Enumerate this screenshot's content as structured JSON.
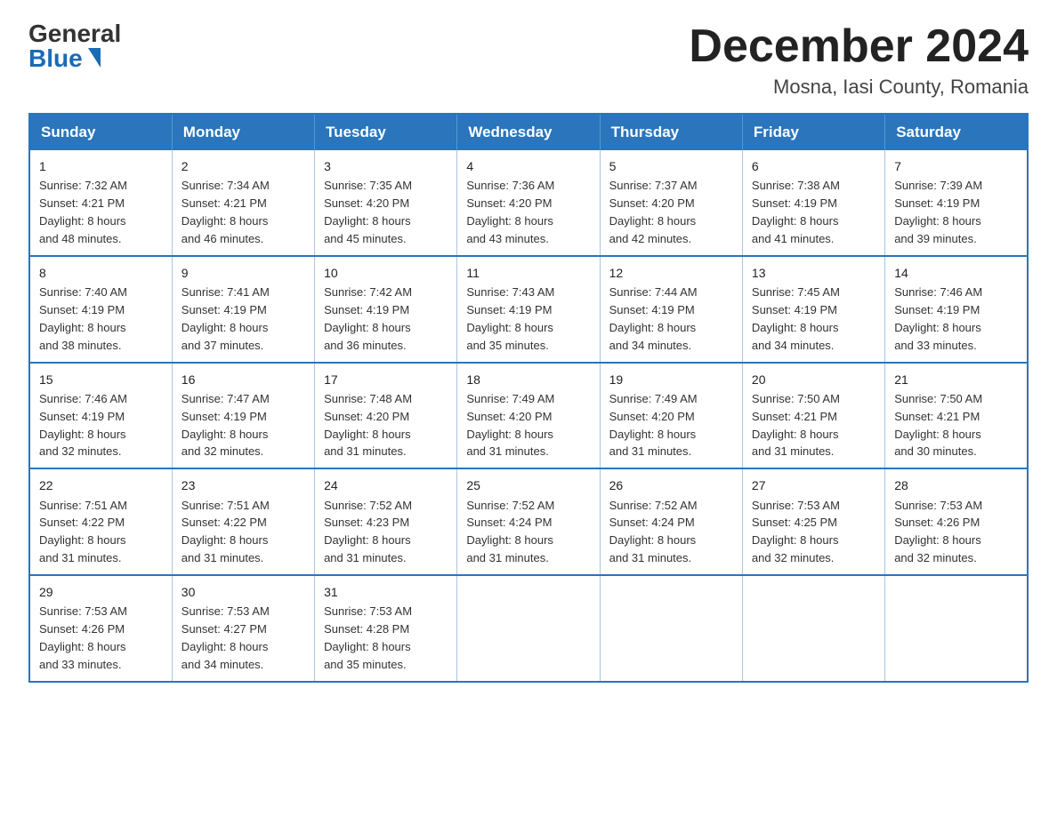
{
  "logo": {
    "general": "General",
    "blue": "Blue",
    "triangle": "▶"
  },
  "title": "December 2024",
  "location": "Mosna, Iasi County, Romania",
  "days_of_week": [
    "Sunday",
    "Monday",
    "Tuesday",
    "Wednesday",
    "Thursday",
    "Friday",
    "Saturday"
  ],
  "weeks": [
    [
      {
        "day": "1",
        "sunrise": "7:32 AM",
        "sunset": "4:21 PM",
        "daylight": "8 hours and 48 minutes."
      },
      {
        "day": "2",
        "sunrise": "7:34 AM",
        "sunset": "4:21 PM",
        "daylight": "8 hours and 46 minutes."
      },
      {
        "day": "3",
        "sunrise": "7:35 AM",
        "sunset": "4:20 PM",
        "daylight": "8 hours and 45 minutes."
      },
      {
        "day": "4",
        "sunrise": "7:36 AM",
        "sunset": "4:20 PM",
        "daylight": "8 hours and 43 minutes."
      },
      {
        "day": "5",
        "sunrise": "7:37 AM",
        "sunset": "4:20 PM",
        "daylight": "8 hours and 42 minutes."
      },
      {
        "day": "6",
        "sunrise": "7:38 AM",
        "sunset": "4:19 PM",
        "daylight": "8 hours and 41 minutes."
      },
      {
        "day": "7",
        "sunrise": "7:39 AM",
        "sunset": "4:19 PM",
        "daylight": "8 hours and 39 minutes."
      }
    ],
    [
      {
        "day": "8",
        "sunrise": "7:40 AM",
        "sunset": "4:19 PM",
        "daylight": "8 hours and 38 minutes."
      },
      {
        "day": "9",
        "sunrise": "7:41 AM",
        "sunset": "4:19 PM",
        "daylight": "8 hours and 37 minutes."
      },
      {
        "day": "10",
        "sunrise": "7:42 AM",
        "sunset": "4:19 PM",
        "daylight": "8 hours and 36 minutes."
      },
      {
        "day": "11",
        "sunrise": "7:43 AM",
        "sunset": "4:19 PM",
        "daylight": "8 hours and 35 minutes."
      },
      {
        "day": "12",
        "sunrise": "7:44 AM",
        "sunset": "4:19 PM",
        "daylight": "8 hours and 34 minutes."
      },
      {
        "day": "13",
        "sunrise": "7:45 AM",
        "sunset": "4:19 PM",
        "daylight": "8 hours and 34 minutes."
      },
      {
        "day": "14",
        "sunrise": "7:46 AM",
        "sunset": "4:19 PM",
        "daylight": "8 hours and 33 minutes."
      }
    ],
    [
      {
        "day": "15",
        "sunrise": "7:46 AM",
        "sunset": "4:19 PM",
        "daylight": "8 hours and 32 minutes."
      },
      {
        "day": "16",
        "sunrise": "7:47 AM",
        "sunset": "4:19 PM",
        "daylight": "8 hours and 32 minutes."
      },
      {
        "day": "17",
        "sunrise": "7:48 AM",
        "sunset": "4:20 PM",
        "daylight": "8 hours and 31 minutes."
      },
      {
        "day": "18",
        "sunrise": "7:49 AM",
        "sunset": "4:20 PM",
        "daylight": "8 hours and 31 minutes."
      },
      {
        "day": "19",
        "sunrise": "7:49 AM",
        "sunset": "4:20 PM",
        "daylight": "8 hours and 31 minutes."
      },
      {
        "day": "20",
        "sunrise": "7:50 AM",
        "sunset": "4:21 PM",
        "daylight": "8 hours and 31 minutes."
      },
      {
        "day": "21",
        "sunrise": "7:50 AM",
        "sunset": "4:21 PM",
        "daylight": "8 hours and 30 minutes."
      }
    ],
    [
      {
        "day": "22",
        "sunrise": "7:51 AM",
        "sunset": "4:22 PM",
        "daylight": "8 hours and 31 minutes."
      },
      {
        "day": "23",
        "sunrise": "7:51 AM",
        "sunset": "4:22 PM",
        "daylight": "8 hours and 31 minutes."
      },
      {
        "day": "24",
        "sunrise": "7:52 AM",
        "sunset": "4:23 PM",
        "daylight": "8 hours and 31 minutes."
      },
      {
        "day": "25",
        "sunrise": "7:52 AM",
        "sunset": "4:24 PM",
        "daylight": "8 hours and 31 minutes."
      },
      {
        "day": "26",
        "sunrise": "7:52 AM",
        "sunset": "4:24 PM",
        "daylight": "8 hours and 31 minutes."
      },
      {
        "day": "27",
        "sunrise": "7:53 AM",
        "sunset": "4:25 PM",
        "daylight": "8 hours and 32 minutes."
      },
      {
        "day": "28",
        "sunrise": "7:53 AM",
        "sunset": "4:26 PM",
        "daylight": "8 hours and 32 minutes."
      }
    ],
    [
      {
        "day": "29",
        "sunrise": "7:53 AM",
        "sunset": "4:26 PM",
        "daylight": "8 hours and 33 minutes."
      },
      {
        "day": "30",
        "sunrise": "7:53 AM",
        "sunset": "4:27 PM",
        "daylight": "8 hours and 34 minutes."
      },
      {
        "day": "31",
        "sunrise": "7:53 AM",
        "sunset": "4:28 PM",
        "daylight": "8 hours and 35 minutes."
      },
      null,
      null,
      null,
      null
    ]
  ],
  "labels": {
    "sunrise": "Sunrise:",
    "sunset": "Sunset:",
    "daylight": "Daylight:"
  }
}
